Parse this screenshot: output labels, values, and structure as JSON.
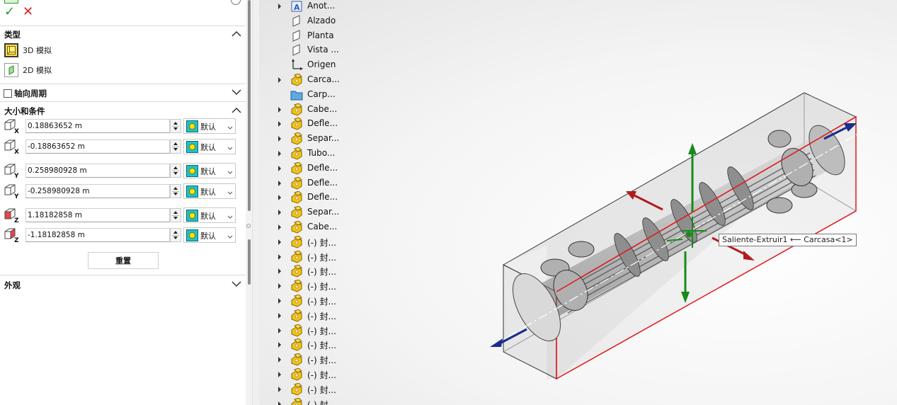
{
  "panel": {
    "confirm_glyph": "✓",
    "cancel_glyph": "✕",
    "type_section": {
      "title": "类型",
      "options": [
        {
          "label": "3D 模拟",
          "icon": "3d-box-icon",
          "selected": true
        },
        {
          "label": "2D 模拟",
          "icon": "2d-plane-icon",
          "selected": false
        }
      ]
    },
    "axial_period": {
      "label": "轴向周期",
      "checked": false
    },
    "size_section": {
      "title": "大小和条件",
      "rows": [
        {
          "value": "0.18863652 m",
          "axis": "X",
          "appearance": "默认"
        },
        {
          "value": "-0.18863652 m",
          "axis": "X",
          "appearance": "默认"
        },
        {
          "value": "0.258980928 m",
          "axis": "Y",
          "appearance": "默认"
        },
        {
          "value": "-0.258980928 m",
          "axis": "Y",
          "appearance": "默认"
        },
        {
          "value": "1.18182858 m",
          "axis": "Z",
          "appearance": "默认"
        },
        {
          "value": "-1.18182858 m",
          "axis": "Z",
          "appearance": "默认"
        }
      ],
      "reset_label": "重置"
    },
    "appearance_section": {
      "title": "外观"
    }
  },
  "tree": {
    "items": [
      {
        "label": "Anot...",
        "icon": "annotation-folder-icon",
        "expandable": true
      },
      {
        "label": "Alzado",
        "icon": "plane-icon",
        "expandable": false
      },
      {
        "label": "Planta",
        "icon": "plane-icon",
        "expandable": false
      },
      {
        "label": "Vista ...",
        "icon": "plane-icon",
        "expandable": false
      },
      {
        "label": "Origen",
        "icon": "origin-icon",
        "expandable": false
      },
      {
        "label": "Carca...",
        "icon": "part-icon",
        "expandable": true
      },
      {
        "label": "Carp...",
        "icon": "folder-icon",
        "expandable": false
      },
      {
        "label": "Cabe...",
        "icon": "part-icon",
        "expandable": true
      },
      {
        "label": "Defle...",
        "icon": "part-icon",
        "expandable": true
      },
      {
        "label": "Separ...",
        "icon": "part-icon",
        "expandable": true
      },
      {
        "label": "Tubo...",
        "icon": "part-icon",
        "expandable": true
      },
      {
        "label": "Defle...",
        "icon": "part-icon",
        "expandable": true
      },
      {
        "label": "Defle...",
        "icon": "part-icon",
        "expandable": true
      },
      {
        "label": "Defle...",
        "icon": "part-icon",
        "expandable": true
      },
      {
        "label": "Separ...",
        "icon": "part-icon",
        "expandable": true
      },
      {
        "label": "Cabe...",
        "icon": "part-icon",
        "expandable": true
      },
      {
        "label": "(-) 封...",
        "icon": "part-icon",
        "expandable": true
      },
      {
        "label": "(-) 封...",
        "icon": "part-icon",
        "expandable": true
      },
      {
        "label": "(-) 封...",
        "icon": "part-icon",
        "expandable": true
      },
      {
        "label": "(-) 封...",
        "icon": "part-icon",
        "expandable": true
      },
      {
        "label": "(-) 封...",
        "icon": "part-icon",
        "expandable": true
      },
      {
        "label": "(-) 封...",
        "icon": "part-icon",
        "expandable": true
      },
      {
        "label": "(-) 封...",
        "icon": "part-icon",
        "expandable": true
      },
      {
        "label": "(-) 封...",
        "icon": "part-icon",
        "expandable": true
      },
      {
        "label": "(-) 封...",
        "icon": "part-icon",
        "expandable": true
      },
      {
        "label": "(-) 封...",
        "icon": "part-icon",
        "expandable": true
      },
      {
        "label": "(-) 封...",
        "icon": "part-icon",
        "expandable": true
      },
      {
        "label": "(-) 封",
        "icon": "part-icon",
        "expandable": true
      }
    ]
  },
  "viewport": {
    "tooltip": "Saliente-Extruir1 ⟵ Carcasa<1>"
  },
  "colors": {
    "accent_check": "#1e9e3a",
    "accent_cancel": "#d42020",
    "triad_green": "#178a1b",
    "triad_red": "#b11c1c",
    "triad_blue": "#1a2d8c",
    "box_edge_red": "#e01818"
  }
}
